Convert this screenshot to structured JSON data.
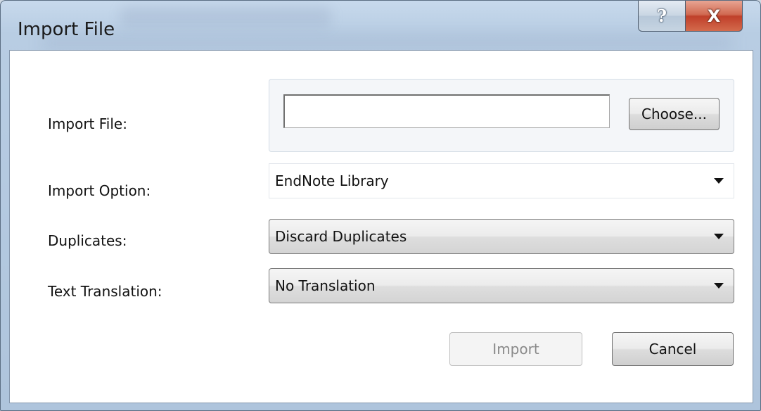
{
  "window": {
    "title": "Import File",
    "help_glyph": "?",
    "close_glyph": "X",
    "help_icon": "help-icon",
    "close_icon": "close-icon"
  },
  "form": {
    "import_file": {
      "label": "Import File:",
      "value": "",
      "button": "Choose..."
    },
    "import_option": {
      "label": "Import Option:",
      "selected": "EndNote Library"
    },
    "duplicates": {
      "label": "Duplicates:",
      "selected": "Discard Duplicates"
    },
    "text_translation": {
      "label": "Text Translation:",
      "selected": "No Translation"
    }
  },
  "buttons": {
    "import": "Import",
    "cancel": "Cancel"
  }
}
